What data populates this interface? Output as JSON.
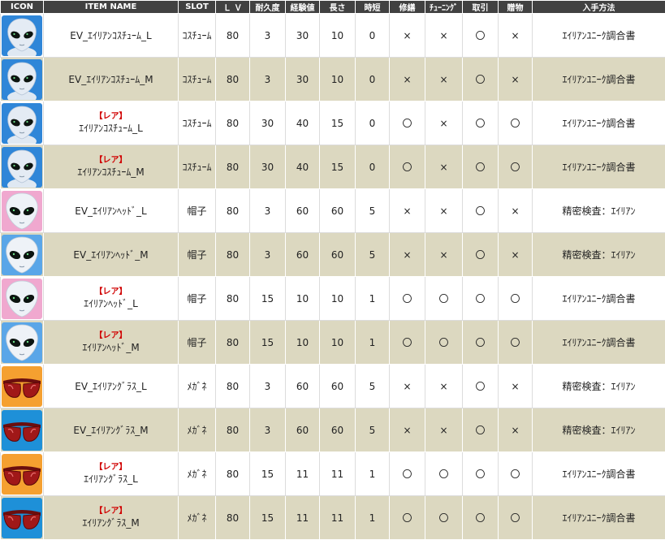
{
  "columns": [
    "ICON",
    "ITEM NAME",
    "SLOT",
    "Ｌ Ｖ",
    "耐久度",
    "経験値",
    "長さ",
    "時短",
    "修繕",
    "ﾁｭｰﾆﾝｸﾞ",
    "取引",
    "贈物",
    "入手方法"
  ],
  "colors": {
    "header_bg": "#414141",
    "header_text": "#ffffff",
    "row_alt": "#dcd8c0",
    "rare_red": "#d00000"
  },
  "rows": [
    {
      "icon": "alien-costume-icon",
      "icon_bg": "#2f86d8",
      "rare_label": "",
      "name": "EV_ｴｲﾘｱﾝｺｽﾁｭｰﾑ_L",
      "slot": "ｺｽﾁｭｰﾑ",
      "lv": "80",
      "durability": "3",
      "exp": "30",
      "length": "10",
      "jitan": "0",
      "repair": "×",
      "tuning": "×",
      "trade": "〇",
      "gift": "×",
      "source": "ｴｲﾘｱﾝﾕﾆｰｸ調合書"
    },
    {
      "icon": "alien-costume-icon",
      "icon_bg": "#2f86d8",
      "rare_label": "",
      "name": "EV_ｴｲﾘｱﾝｺｽﾁｭｰﾑ_M",
      "slot": "ｺｽﾁｭｰﾑ",
      "lv": "80",
      "durability": "3",
      "exp": "30",
      "length": "10",
      "jitan": "0",
      "repair": "×",
      "tuning": "×",
      "trade": "〇",
      "gift": "×",
      "source": "ｴｲﾘｱﾝﾕﾆｰｸ調合書"
    },
    {
      "icon": "alien-costume-icon",
      "icon_bg": "#2f86d8",
      "rare_label": "【レア】",
      "name": "ｴｲﾘｱﾝｺｽﾁｭｰﾑ_L",
      "slot": "ｺｽﾁｭｰﾑ",
      "lv": "80",
      "durability": "30",
      "exp": "40",
      "length": "15",
      "jitan": "0",
      "repair": "〇",
      "tuning": "×",
      "trade": "〇",
      "gift": "〇",
      "source": "ｴｲﾘｱﾝﾕﾆｰｸ調合書"
    },
    {
      "icon": "alien-costume-icon",
      "icon_bg": "#2f86d8",
      "rare_label": "【レア】",
      "name": "ｴｲﾘｱﾝｺｽﾁｭｰﾑ_M",
      "slot": "ｺｽﾁｭｰﾑ",
      "lv": "80",
      "durability": "30",
      "exp": "40",
      "length": "15",
      "jitan": "0",
      "repair": "〇",
      "tuning": "×",
      "trade": "〇",
      "gift": "〇",
      "source": "ｴｲﾘｱﾝﾕﾆｰｸ調合書"
    },
    {
      "icon": "alien-head-icon",
      "icon_bg": "#f0a8cf",
      "rare_label": "",
      "name": "EV_ｴｲﾘｱﾝﾍｯﾄﾞ_L",
      "slot": "帽子",
      "lv": "80",
      "durability": "3",
      "exp": "60",
      "length": "60",
      "jitan": "5",
      "repair": "×",
      "tuning": "×",
      "trade": "〇",
      "gift": "×",
      "source": "精密検査：ｴｲﾘｱﾝ"
    },
    {
      "icon": "alien-head-icon",
      "icon_bg": "#5aa6e8",
      "rare_label": "",
      "name": "EV_ｴｲﾘｱﾝﾍｯﾄﾞ_M",
      "slot": "帽子",
      "lv": "80",
      "durability": "3",
      "exp": "60",
      "length": "60",
      "jitan": "5",
      "repair": "×",
      "tuning": "×",
      "trade": "〇",
      "gift": "×",
      "source": "精密検査：ｴｲﾘｱﾝ"
    },
    {
      "icon": "alien-head-icon",
      "icon_bg": "#f0a8cf",
      "rare_label": "【レア】",
      "name": "ｴｲﾘｱﾝﾍｯﾄﾞ_L",
      "slot": "帽子",
      "lv": "80",
      "durability": "15",
      "exp": "10",
      "length": "10",
      "jitan": "1",
      "repair": "〇",
      "tuning": "〇",
      "trade": "〇",
      "gift": "〇",
      "source": "ｴｲﾘｱﾝﾕﾆｰｸ調合書"
    },
    {
      "icon": "alien-head-icon",
      "icon_bg": "#5aa6e8",
      "rare_label": "【レア】",
      "name": "ｴｲﾘｱﾝﾍｯﾄﾞ_M",
      "slot": "帽子",
      "lv": "80",
      "durability": "15",
      "exp": "10",
      "length": "10",
      "jitan": "1",
      "repair": "〇",
      "tuning": "〇",
      "trade": "〇",
      "gift": "〇",
      "source": "ｴｲﾘｱﾝﾕﾆｰｸ調合書"
    },
    {
      "icon": "sunglasses-icon",
      "icon_bg": "#f5a030",
      "rare_label": "",
      "name": "EV_ｴｲﾘｱﾝｸﾞﾗｽ_L",
      "slot": "ﾒｶﾞﾈ",
      "lv": "80",
      "durability": "3",
      "exp": "60",
      "length": "60",
      "jitan": "5",
      "repair": "×",
      "tuning": "×",
      "trade": "〇",
      "gift": "×",
      "source": "精密検査：ｴｲﾘｱﾝ"
    },
    {
      "icon": "sunglasses-icon",
      "icon_bg": "#1e90d8",
      "rare_label": "",
      "name": "EV_ｴｲﾘｱﾝｸﾞﾗｽ_M",
      "slot": "ﾒｶﾞﾈ",
      "lv": "80",
      "durability": "3",
      "exp": "60",
      "length": "60",
      "jitan": "5",
      "repair": "×",
      "tuning": "×",
      "trade": "〇",
      "gift": "×",
      "source": "精密検査：ｴｲﾘｱﾝ"
    },
    {
      "icon": "sunglasses-icon",
      "icon_bg": "#f5a030",
      "rare_label": "【レア】",
      "name": "ｴｲﾘｱﾝｸﾞﾗｽ_L",
      "slot": "ﾒｶﾞﾈ",
      "lv": "80",
      "durability": "15",
      "exp": "11",
      "length": "11",
      "jitan": "1",
      "repair": "〇",
      "tuning": "〇",
      "trade": "〇",
      "gift": "〇",
      "source": "ｴｲﾘｱﾝﾕﾆｰｸ調合書"
    },
    {
      "icon": "sunglasses-icon",
      "icon_bg": "#1e90d8",
      "rare_label": "【レア】",
      "name": "ｴｲﾘｱﾝｸﾞﾗｽ_M",
      "slot": "ﾒｶﾞﾈ",
      "lv": "80",
      "durability": "15",
      "exp": "11",
      "length": "11",
      "jitan": "1",
      "repair": "〇",
      "tuning": "〇",
      "trade": "〇",
      "gift": "〇",
      "source": "ｴｲﾘｱﾝﾕﾆｰｸ調合書"
    }
  ]
}
